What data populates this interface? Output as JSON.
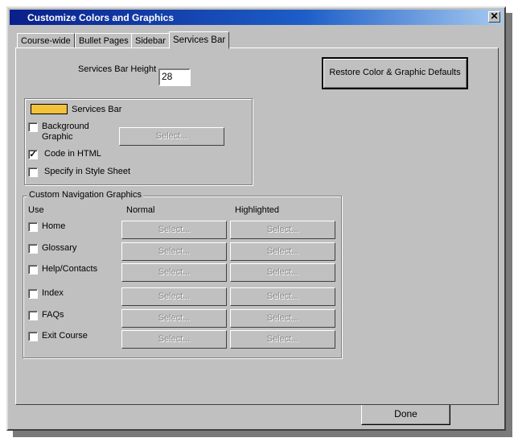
{
  "window": {
    "title": "Customize Colors and Graphics",
    "close_glyph": "✕"
  },
  "tabs": [
    {
      "label": "Course-wide"
    },
    {
      "label": "Bullet Pages"
    },
    {
      "label": "Sidebar"
    },
    {
      "label": "Services Bar",
      "active": true
    }
  ],
  "services_bar": {
    "height_label": "Services Bar Height",
    "height_value": "28",
    "restore_button": "Restore Color & Graphic Defaults",
    "color_label": "Services Bar",
    "color_swatch": "#f4c13a",
    "background_graphic_label": "Background Graphic",
    "background_graphic_checked": false,
    "select_label": "Select...",
    "code_in_html_label": "Code in HTML",
    "code_in_html_checked": true,
    "check_glyph": "✓",
    "style_sheet_label": "Specify in Style Sheet",
    "style_sheet_checked": false
  },
  "nav_graphics": {
    "title": "Custom Navigation Graphics",
    "headers": {
      "use": "Use",
      "normal": "Normal",
      "highlighted": "Highlighted"
    },
    "select_label": "Select...",
    "rows": [
      {
        "label": "Home",
        "checked": false
      },
      {
        "label": "Glossary",
        "checked": false
      },
      {
        "label": "Help/Contacts",
        "checked": false
      },
      {
        "label": "Index",
        "checked": false
      },
      {
        "label": "FAQs",
        "checked": false
      },
      {
        "label": "Exit Course",
        "checked": false
      }
    ]
  },
  "footer": {
    "done_button": "Done"
  }
}
